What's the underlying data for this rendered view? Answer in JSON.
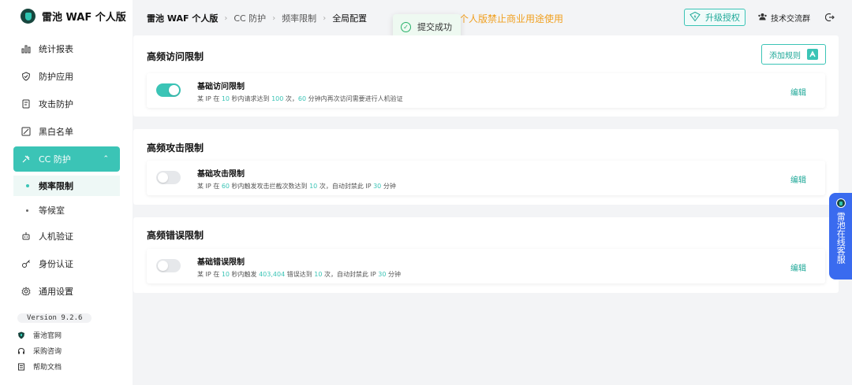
{
  "app": {
    "title": "雷池 WAF 个人版"
  },
  "sidebar": {
    "items": [
      {
        "label": "统计报表",
        "icon": "chart-icon"
      },
      {
        "label": "防护应用",
        "icon": "shield-icon"
      },
      {
        "label": "攻击防护",
        "icon": "document-icon"
      },
      {
        "label": "黑白名单",
        "icon": "list-icon"
      },
      {
        "label": "CC 防护",
        "icon": "cc-icon",
        "active": true
      },
      {
        "label": "人机验证",
        "icon": "robot-icon"
      },
      {
        "label": "身份认证",
        "icon": "key-icon"
      },
      {
        "label": "通用设置",
        "icon": "gear-icon"
      }
    ],
    "sub_items": [
      {
        "label": "频率限制",
        "active": true
      },
      {
        "label": "等候室"
      }
    ],
    "version": "Version 9.2.6",
    "links": [
      {
        "label": "雷池官网",
        "icon": "shield-logo-icon"
      },
      {
        "label": "采购咨询",
        "icon": "headset-icon"
      },
      {
        "label": "帮助文档",
        "icon": "doc-icon"
      }
    ]
  },
  "header": {
    "breadcrumb": [
      "雷池 WAF 个人版",
      "CC 防护",
      "频率限制",
      "全局配置"
    ],
    "warning": "个人版禁止商业用途使用",
    "toast": "提交成功",
    "upgrade_label": "升级授权",
    "group_label": "技术交流群"
  },
  "panels": [
    {
      "title": "高频访问限制",
      "add_label": "添加规则",
      "rule": {
        "name": "基础访问限制",
        "enabled": true,
        "desc": [
          "某 IP 在 ",
          "10",
          " 秒内请求达到 ",
          "100",
          " 次，",
          "60",
          " 分钟内再次访问需要进行人机验证"
        ],
        "edit": "编辑"
      }
    },
    {
      "title": "高频攻击限制",
      "rule": {
        "name": "基础攻击限制",
        "enabled": false,
        "desc": [
          "某 IP 在 ",
          "60",
          " 秒内触发攻击拦截次数达到 ",
          "10",
          " 次，自动封禁此 IP ",
          "30",
          " 分钟"
        ],
        "edit": "编辑"
      }
    },
    {
      "title": "高频错误限制",
      "rule": {
        "name": "基础错误限制",
        "enabled": false,
        "desc": [
          "某 IP 在 ",
          "10",
          " 秒内触发 ",
          "403,404",
          " 错误达到 ",
          "10",
          " 次，自动封禁此 IP ",
          "30",
          " 分钟"
        ],
        "edit": "编辑"
      }
    }
  ],
  "support": {
    "label": "雷池在线客服"
  },
  "colors": {
    "accent": "#3bc4b6",
    "warning": "#f0a020",
    "support": "#3a6bef"
  }
}
